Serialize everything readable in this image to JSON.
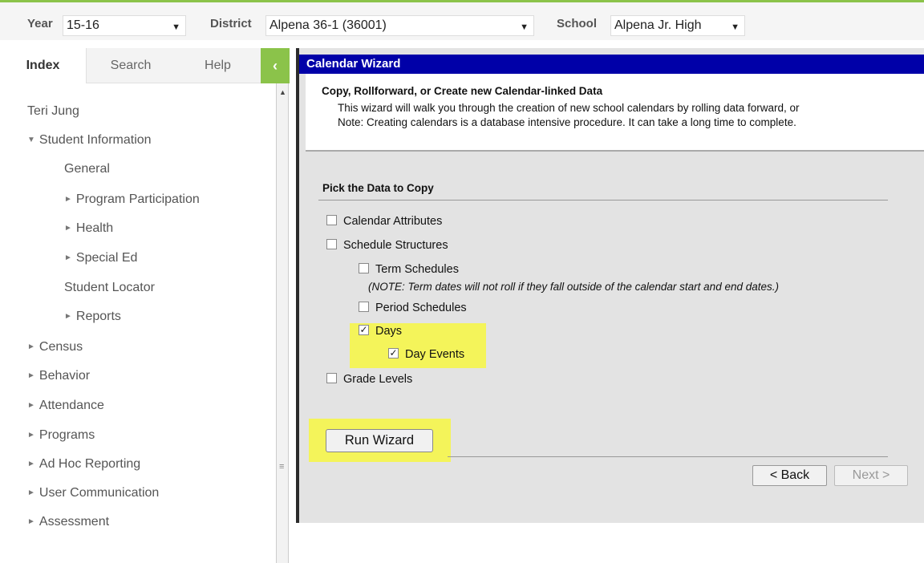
{
  "topbar": {
    "year_label": "Year",
    "year_value": "15-16",
    "district_label": "District",
    "district_value": "Alpena 36-1 (36001)",
    "school_label": "School",
    "school_value": "Alpena Jr. High"
  },
  "tabs": [
    "Index",
    "Search",
    "Help"
  ],
  "collapse_glyph": "‹",
  "sidebar": {
    "user": "Teri Jung",
    "items": [
      {
        "label": "Student Information",
        "arrow": "▼"
      },
      {
        "label": "General",
        "arrow": ""
      },
      {
        "label": "Program Participation",
        "arrow": "►"
      },
      {
        "label": "Health",
        "arrow": "►"
      },
      {
        "label": "Special Ed",
        "arrow": "►"
      },
      {
        "label": "Student Locator",
        "arrow": ""
      },
      {
        "label": "Reports",
        "arrow": "►"
      },
      {
        "label": "Census",
        "arrow": "►"
      },
      {
        "label": "Behavior",
        "arrow": "►"
      },
      {
        "label": "Attendance",
        "arrow": "►"
      },
      {
        "label": "Programs",
        "arrow": "►"
      },
      {
        "label": "Ad Hoc Reporting",
        "arrow": "►"
      },
      {
        "label": "User Communication",
        "arrow": "►"
      },
      {
        "label": "Assessment",
        "arrow": "►"
      }
    ]
  },
  "main": {
    "title": "Calendar Wizard",
    "intro_title": "Copy, Rollforward, or Create new Calendar-linked Data",
    "intro_line1": "This wizard will walk you through the creation of new school calendars by rolling data forward, or",
    "intro_line2": "Note: Creating calendars is a database intensive procedure. It can take a long time to complete.",
    "section_title": "Pick the Data to Copy",
    "options": [
      {
        "label": "Calendar Attributes",
        "checked": false
      },
      {
        "label": "Schedule Structures",
        "checked": false
      },
      {
        "label": "Term Schedules",
        "checked": false
      },
      {
        "label": "Period Schedules",
        "checked": false
      },
      {
        "label": "Days",
        "checked": true
      },
      {
        "label": "Day Events",
        "checked": true
      },
      {
        "label": "Grade Levels",
        "checked": false
      }
    ],
    "term_note": "(NOTE: Term dates will not roll if they fall outside of the calendar start and end dates.)",
    "run_button": "Run Wizard",
    "back_button": "< Back",
    "next_button": "Next >",
    "highlight_color": "#f4f45a"
  }
}
